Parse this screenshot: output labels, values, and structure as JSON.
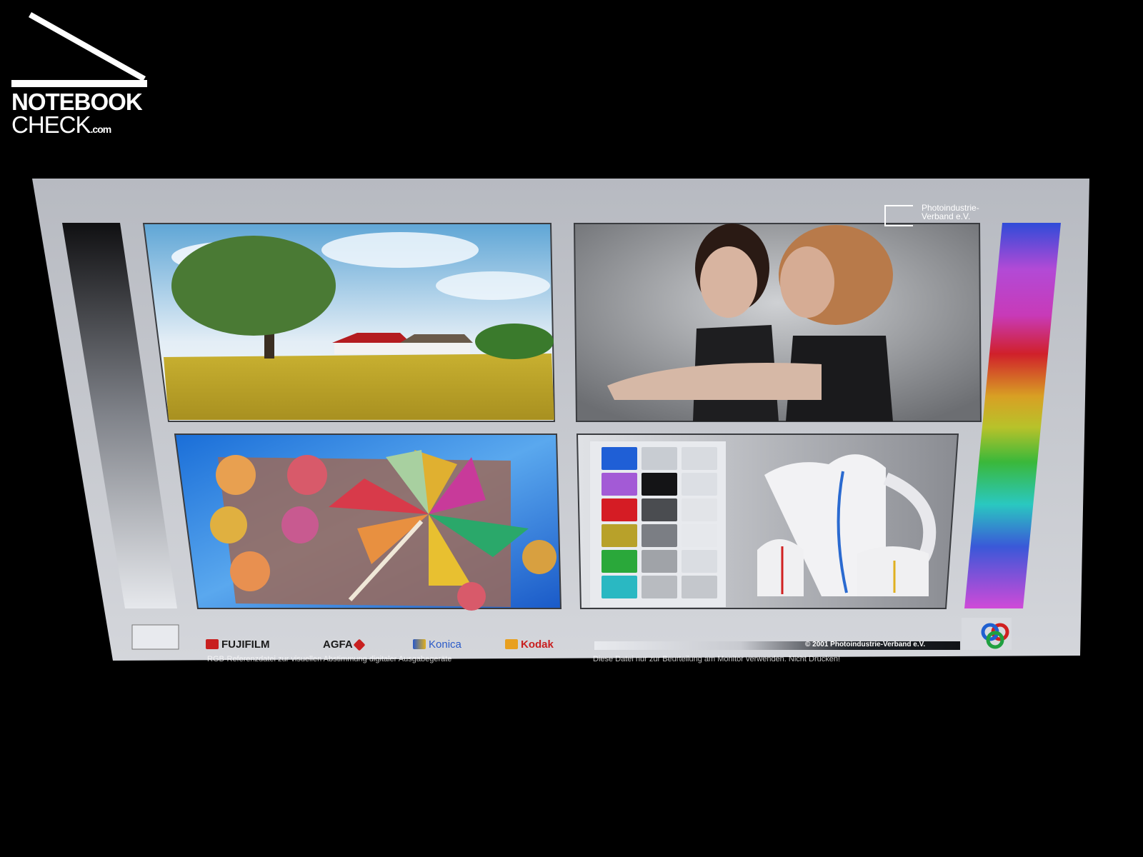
{
  "logo": {
    "line1": "NOTEBOOK",
    "line2": "CHECK",
    "suffix": ".com"
  },
  "test_image": {
    "publisher": [
      "Photoindustrie-",
      "Verband e.V."
    ],
    "brands": [
      "FUJIFILM",
      "AGFA",
      "Konica",
      "Kodak"
    ],
    "copyright": "© 2001 Photoindustrie-Verband e.V.",
    "footer_left": "RGB-Referenzdatei zur visuellen Abstimmung digitaler Ausgabegeräte",
    "footer_right": "Diese Datei  nur zur Beurteilung am Monitor verwenden. Nicht Drucken!",
    "panels": [
      "landscape-photo",
      "portrait-photo",
      "pinwheel-photo",
      "still-life-photo"
    ]
  },
  "colors": {
    "background": "#000000",
    "frame": "#b9bcc3",
    "swatches_left": [
      "#1f5fd6",
      "#a35ad6",
      "#d51c24",
      "#b8a12a",
      "#2aa83a",
      "#2ab8c2"
    ],
    "swatches_gray": [
      "#c8ccd2",
      "#141416",
      "#4a4c50",
      "#7b7e84",
      "#a0a3a8",
      "#b8bbc0"
    ]
  }
}
